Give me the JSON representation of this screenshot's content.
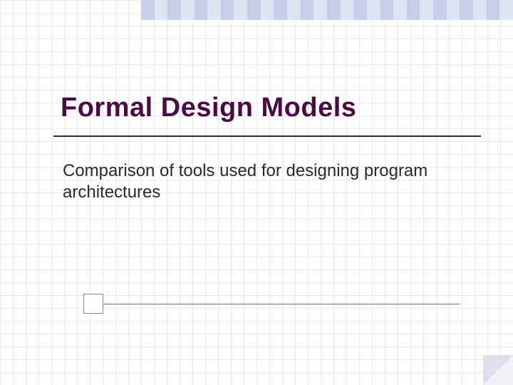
{
  "slide": {
    "title": "Formal Design Models",
    "subtitle": "Comparison of tools used for designing program architectures"
  }
}
